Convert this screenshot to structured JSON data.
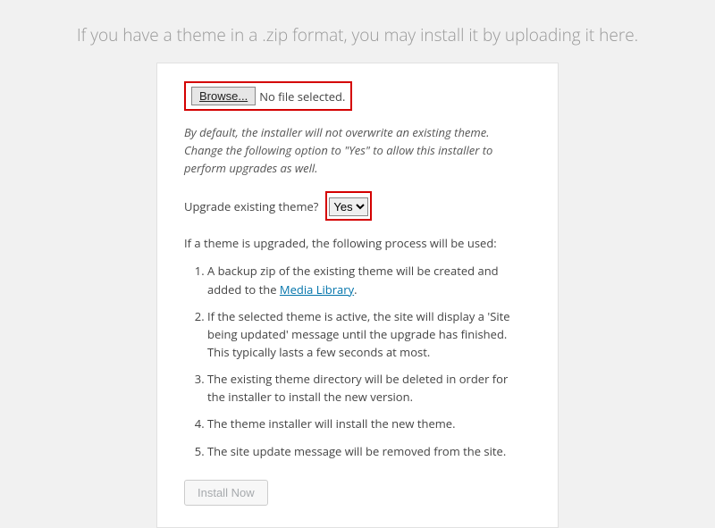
{
  "intro": "If you have a theme in a .zip format, you may install it by uploading it here.",
  "browse_button": "Browse...",
  "file_status": "No file selected.",
  "note": "By default, the installer will not overwrite an existing theme. Change the following option to \"Yes\" to allow this installer to perform upgrades as well.",
  "upgrade_label": "Upgrade existing theme?",
  "upgrade_value": "Yes",
  "process_intro": "If a theme is upgraded, the following process will be used:",
  "step1_pre": "A backup zip of the existing theme will be created and added to the ",
  "step1_link": "Media Library",
  "step1_post": ".",
  "step2": "If the selected theme is active, the site will display a 'Site being updated' message until the upgrade has finished. This typically lasts a few seconds at most.",
  "step3": "The existing theme directory will be deleted in order for the installer to install the new version.",
  "step4": "The theme installer will install the new theme.",
  "step5": "The site update message will be removed from the site.",
  "install_button": "Install Now"
}
